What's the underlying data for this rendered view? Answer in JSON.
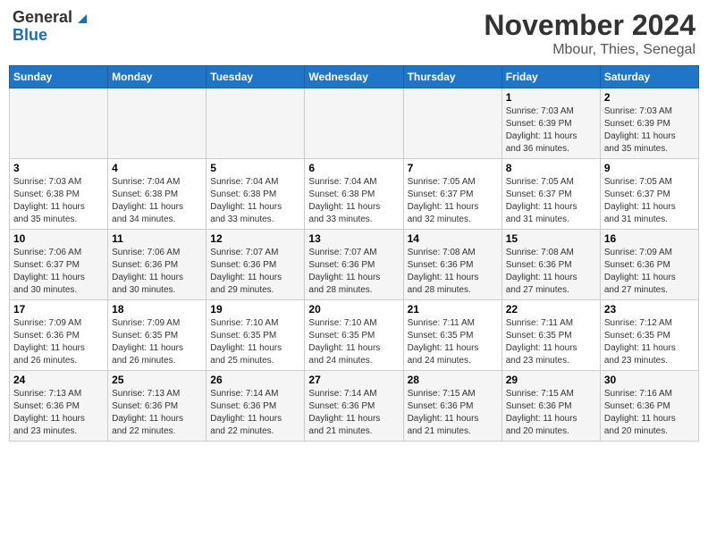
{
  "logo": {
    "line1": "General",
    "line2": "Blue"
  },
  "title": "November 2024",
  "location": "Mbour, Thies, Senegal",
  "weekdays": [
    "Sunday",
    "Monday",
    "Tuesday",
    "Wednesday",
    "Thursday",
    "Friday",
    "Saturday"
  ],
  "weeks": [
    [
      {
        "day": "",
        "info": ""
      },
      {
        "day": "",
        "info": ""
      },
      {
        "day": "",
        "info": ""
      },
      {
        "day": "",
        "info": ""
      },
      {
        "day": "",
        "info": ""
      },
      {
        "day": "1",
        "info": "Sunrise: 7:03 AM\nSunset: 6:39 PM\nDaylight: 11 hours\nand 36 minutes."
      },
      {
        "day": "2",
        "info": "Sunrise: 7:03 AM\nSunset: 6:39 PM\nDaylight: 11 hours\nand 35 minutes."
      }
    ],
    [
      {
        "day": "3",
        "info": "Sunrise: 7:03 AM\nSunset: 6:38 PM\nDaylight: 11 hours\nand 35 minutes."
      },
      {
        "day": "4",
        "info": "Sunrise: 7:04 AM\nSunset: 6:38 PM\nDaylight: 11 hours\nand 34 minutes."
      },
      {
        "day": "5",
        "info": "Sunrise: 7:04 AM\nSunset: 6:38 PM\nDaylight: 11 hours\nand 33 minutes."
      },
      {
        "day": "6",
        "info": "Sunrise: 7:04 AM\nSunset: 6:38 PM\nDaylight: 11 hours\nand 33 minutes."
      },
      {
        "day": "7",
        "info": "Sunrise: 7:05 AM\nSunset: 6:37 PM\nDaylight: 11 hours\nand 32 minutes."
      },
      {
        "day": "8",
        "info": "Sunrise: 7:05 AM\nSunset: 6:37 PM\nDaylight: 11 hours\nand 31 minutes."
      },
      {
        "day": "9",
        "info": "Sunrise: 7:05 AM\nSunset: 6:37 PM\nDaylight: 11 hours\nand 31 minutes."
      }
    ],
    [
      {
        "day": "10",
        "info": "Sunrise: 7:06 AM\nSunset: 6:37 PM\nDaylight: 11 hours\nand 30 minutes."
      },
      {
        "day": "11",
        "info": "Sunrise: 7:06 AM\nSunset: 6:36 PM\nDaylight: 11 hours\nand 30 minutes."
      },
      {
        "day": "12",
        "info": "Sunrise: 7:07 AM\nSunset: 6:36 PM\nDaylight: 11 hours\nand 29 minutes."
      },
      {
        "day": "13",
        "info": "Sunrise: 7:07 AM\nSunset: 6:36 PM\nDaylight: 11 hours\nand 28 minutes."
      },
      {
        "day": "14",
        "info": "Sunrise: 7:08 AM\nSunset: 6:36 PM\nDaylight: 11 hours\nand 28 minutes."
      },
      {
        "day": "15",
        "info": "Sunrise: 7:08 AM\nSunset: 6:36 PM\nDaylight: 11 hours\nand 27 minutes."
      },
      {
        "day": "16",
        "info": "Sunrise: 7:09 AM\nSunset: 6:36 PM\nDaylight: 11 hours\nand 27 minutes."
      }
    ],
    [
      {
        "day": "17",
        "info": "Sunrise: 7:09 AM\nSunset: 6:36 PM\nDaylight: 11 hours\nand 26 minutes."
      },
      {
        "day": "18",
        "info": "Sunrise: 7:09 AM\nSunset: 6:35 PM\nDaylight: 11 hours\nand 26 minutes."
      },
      {
        "day": "19",
        "info": "Sunrise: 7:10 AM\nSunset: 6:35 PM\nDaylight: 11 hours\nand 25 minutes."
      },
      {
        "day": "20",
        "info": "Sunrise: 7:10 AM\nSunset: 6:35 PM\nDaylight: 11 hours\nand 24 minutes."
      },
      {
        "day": "21",
        "info": "Sunrise: 7:11 AM\nSunset: 6:35 PM\nDaylight: 11 hours\nand 24 minutes."
      },
      {
        "day": "22",
        "info": "Sunrise: 7:11 AM\nSunset: 6:35 PM\nDaylight: 11 hours\nand 23 minutes."
      },
      {
        "day": "23",
        "info": "Sunrise: 7:12 AM\nSunset: 6:35 PM\nDaylight: 11 hours\nand 23 minutes."
      }
    ],
    [
      {
        "day": "24",
        "info": "Sunrise: 7:13 AM\nSunset: 6:36 PM\nDaylight: 11 hours\nand 23 minutes."
      },
      {
        "day": "25",
        "info": "Sunrise: 7:13 AM\nSunset: 6:36 PM\nDaylight: 11 hours\nand 22 minutes."
      },
      {
        "day": "26",
        "info": "Sunrise: 7:14 AM\nSunset: 6:36 PM\nDaylight: 11 hours\nand 22 minutes."
      },
      {
        "day": "27",
        "info": "Sunrise: 7:14 AM\nSunset: 6:36 PM\nDaylight: 11 hours\nand 21 minutes."
      },
      {
        "day": "28",
        "info": "Sunrise: 7:15 AM\nSunset: 6:36 PM\nDaylight: 11 hours\nand 21 minutes."
      },
      {
        "day": "29",
        "info": "Sunrise: 7:15 AM\nSunset: 6:36 PM\nDaylight: 11 hours\nand 20 minutes."
      },
      {
        "day": "30",
        "info": "Sunrise: 7:16 AM\nSunset: 6:36 PM\nDaylight: 11 hours\nand 20 minutes."
      }
    ]
  ]
}
